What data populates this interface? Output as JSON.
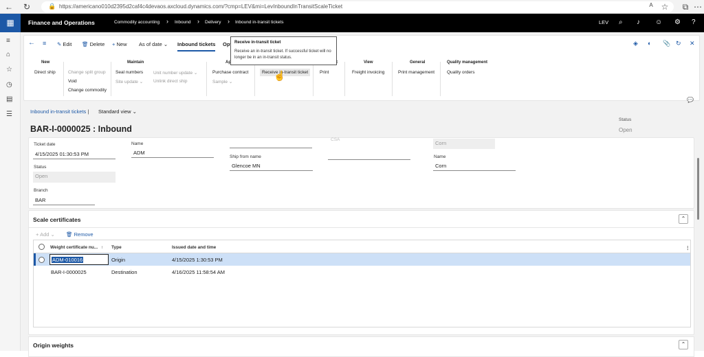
{
  "browser": {
    "url": "https://americano010d2395d2caf4c4devaos.axcloud.dynamics.com/?cmp=LEV&mi=LevInboundInTransitScaleTicket"
  },
  "topbar": {
    "app_title": "Finance and Operations",
    "breadcrumbs": [
      "Commodity accounting",
      "Inbound",
      "Delivery",
      "Inbound in-transit tickets"
    ],
    "company": "LEV"
  },
  "toolbar": {
    "edit": "Edit",
    "delete": "Delete",
    "new": "New",
    "as_of_date": "As of date",
    "tab_inbound_tickets": "Inbound tickets",
    "tab_options": "Opt"
  },
  "groups": {
    "new": {
      "header": "New",
      "items": [
        "Direct ship"
      ]
    },
    "misc": {
      "items": [
        "Change split group",
        "Void",
        "Change commodity"
      ]
    },
    "maintain": {
      "header": "Maintain",
      "items": [
        "Seal numbers",
        "Site update",
        "Unit number update",
        "Unlink direct ship"
      ]
    },
    "app": {
      "header": "App",
      "items": [
        "Purchase contract",
        "Sample"
      ]
    },
    "receive": {
      "items": [
        "Receive in-transit ticket"
      ]
    },
    "print": {
      "header": "t",
      "items": [
        "Print"
      ]
    },
    "view": {
      "header": "View",
      "items": [
        "Freight invoicing"
      ]
    },
    "general": {
      "header": "General",
      "items": [
        "Print management"
      ]
    },
    "quality": {
      "header": "Quality management",
      "items": [
        "Quality orders"
      ]
    }
  },
  "tooltip": {
    "title": "Receive in-transit ticket",
    "body": "Receive an in-transit ticket. If successful ticket will no longer be in an in-transit status."
  },
  "page": {
    "breadcrumb": "Inbound in-transit tickets",
    "separator": "|",
    "view": "Standard view",
    "title": "BAR-I-0000025 : Inbound",
    "status_label": "Status",
    "status_value": "Open"
  },
  "header_fields": {
    "ticket_date_label": "Ticket date",
    "ticket_date": "4/15/2025 01:30:53 PM",
    "status_label": "Status",
    "status": "Open",
    "branch_label": "Branch",
    "branch": "BAR",
    "name_label": "Name",
    "name": "ADM",
    "ship_from_label": "Ship from name",
    "ship_from": "Glencoe MN",
    "commodity_partial_label": "CSA",
    "commodity_code": "Corn",
    "commodity_name_label": "Name",
    "commodity_name": "Corn"
  },
  "scale_certificates": {
    "title": "Scale certificates",
    "add": "Add",
    "remove": "Remove",
    "columns": [
      "Weight certificate nu...",
      "Type",
      "Issued date and time"
    ],
    "rows": [
      {
        "cert": "ADM-010016",
        "type": "Origin",
        "issued": "4/15/2025 1:30:53 PM"
      },
      {
        "cert": "BAR-I-0000025",
        "type": "Destination",
        "issued": "4/16/2025 11:58:54 AM"
      }
    ]
  },
  "origin_weights": {
    "title": "Origin weights"
  }
}
